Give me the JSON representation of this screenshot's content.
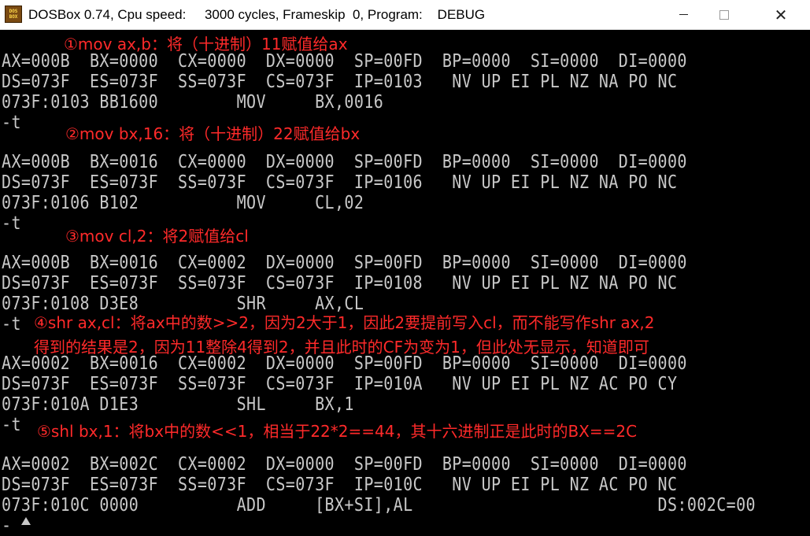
{
  "window": {
    "title": "DOSBox 0.74, Cpu speed:     3000 cycles, Frameskip  0, Program:    DEBUG",
    "icon_text_top": "DOS",
    "icon_text_bottom": "BOX",
    "minimize_icon": "minimize-icon",
    "maximize_icon": "maximize-icon",
    "close_icon": "close-icon"
  },
  "console": {
    "lines": [
      "AX=000B  BX=0000  CX=0000  DX=0000  SP=00FD  BP=0000  SI=0000  DI=0000",
      "DS=073F  ES=073F  SS=073F  CS=073F  IP=0103   NV UP EI PL NZ NA PO NC",
      "073F:0103 BB1600        MOV     BX,0016",
      "-t",
      "",
      "AX=000B  BX=0016  CX=0000  DX=0000  SP=00FD  BP=0000  SI=0000  DI=0000",
      "DS=073F  ES=073F  SS=073F  CS=073F  IP=0106   NV UP EI PL NZ NA PO NC",
      "073F:0106 B102          MOV     CL,02",
      "-t",
      "",
      "AX=000B  BX=0016  CX=0002  DX=0000  SP=00FD  BP=0000  SI=0000  DI=0000",
      "DS=073F  ES=073F  SS=073F  CS=073F  IP=0108   NV UP EI PL NZ NA PO NC",
      "073F:0108 D3E8          SHR     AX,CL",
      "-t",
      "",
      "AX=0002  BX=0016  CX=0002  DX=0000  SP=00FD  BP=0000  SI=0000  DI=0000",
      "DS=073F  ES=073F  SS=073F  CS=073F  IP=010A   NV UP EI PL NZ AC PO CY",
      "073F:010A D1E3          SHL     BX,1",
      "-t",
      "",
      "AX=0002  BX=002C  CX=0002  DX=0000  SP=00FD  BP=0000  SI=0000  DI=0000",
      "DS=073F  ES=073F  SS=073F  CS=073F  IP=010C   NV UP EI PL NZ AC PO NC",
      "073F:010C 0000          ADD     [BX+SI],AL                         DS:002C=00",
      "-"
    ]
  },
  "annotations": {
    "a1": "①mov ax,b：将（十进制）11赋值给ax",
    "a2": "②mov bx,16：将（十进制）22赋值给bx",
    "a3": "③mov cl,2：将2赋值给cl",
    "a4": "④shr ax,cl：将ax中的数>>2，因为2大于1，因此2要提前写入cl，而不能写作shr ax,2",
    "a4b": "得到的结果是2，因为11整除4得到2，并且此时的CF为变为1，但此处无显示，知道即可",
    "a5": "⑤shl bx,1：将bx中的数<<1，相当于22*2==44，其十六进制正是此时的BX==2C"
  },
  "colors": {
    "console_text": "#c8c8c8",
    "console_bg": "#000000",
    "annotation": "#ff2a2a"
  }
}
